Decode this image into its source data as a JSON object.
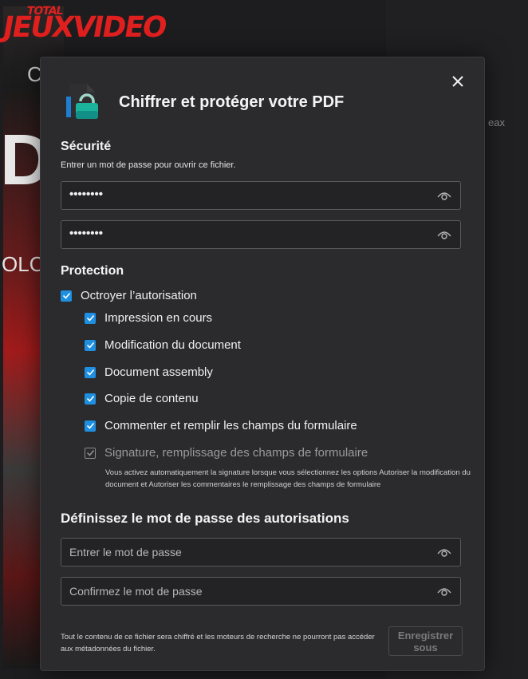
{
  "background": {
    "logo_top": "TOTAL",
    "logo_main": "JEUXVIDEO",
    "letter_c": "C",
    "big_letters": "DI",
    "olc": "OLC",
    "right_text": "eax"
  },
  "dialog": {
    "title": "Chiffrer et protéger votre PDF",
    "close_icon": "close-icon",
    "app_icon": "lock-document-icon",
    "security": {
      "heading": "Sécurité",
      "subtitle": "Entrer un mot de passe pour ouvrir ce fichier.",
      "password_value": "••••••••",
      "confirm_value": "••••••••"
    },
    "protection": {
      "heading": "Protection",
      "grant": {
        "label": "Octroyer l’autorisation",
        "checked": true
      },
      "options": [
        {
          "label": "Impression en cours",
          "checked": true
        },
        {
          "label": "Modification du document",
          "checked": true
        },
        {
          "label": "Document assembly",
          "checked": true
        },
        {
          "label": "Copie de contenu",
          "checked": true
        },
        {
          "label": "Commenter et remplir les champs du formulaire",
          "checked": true
        }
      ],
      "signature": {
        "label": "Signature, remplissage des champs de formulaire",
        "checked": true,
        "disabled": true
      },
      "signature_note": "Vous activez automatiquement la signature lorsque vous sélectionnez les options Autoriser la modification du document et Autoriser les commentaires le remplissage des champs de formulaire"
    },
    "permissions": {
      "heading": "Définissez le mot de passe des autorisations",
      "password_placeholder": "Entrer le mot de passe",
      "confirm_placeholder": "Confirmez le mot de passe"
    },
    "footer": {
      "text": "Tout le contenu de ce fichier sera chiffré et les moteurs de recherche ne pourront pas accéder aux métadonnées du fichier.",
      "save_label": "Enregistrer sous"
    }
  },
  "colors": {
    "accent": "#1e8fe1",
    "dialog_bg": "#2b2b2d",
    "logo_red": "#e0201f"
  }
}
